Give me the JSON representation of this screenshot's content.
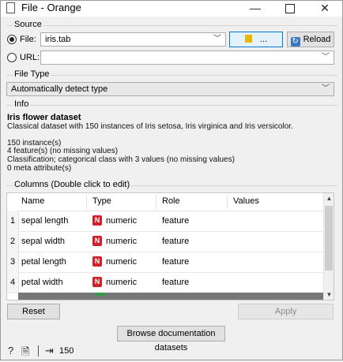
{
  "window": {
    "title": "File - Orange",
    "minimize": "—",
    "close": "✕"
  },
  "source": {
    "group_label": "Source",
    "file_label": "File:",
    "file_value": "iris.tab",
    "browse_label": "...",
    "reload_label": "Reload",
    "url_label": "URL:",
    "url_value": ""
  },
  "file_type": {
    "group_label": "File Type",
    "value": "Automatically detect type"
  },
  "info": {
    "group_label": "Info",
    "title": "Iris flower dataset",
    "description": "Classical dataset with 150 instances of Iris setosa, Iris virginica and Iris versicolor.",
    "lines": [
      "150 instance(s)",
      "4 feature(s) (no missing values)",
      "Classification; categorical class with 3 values (no missing values)",
      "0 meta attribute(s)"
    ]
  },
  "columns": {
    "group_label": "Columns (Double click to edit)",
    "headers": [
      "Name",
      "Type",
      "Role",
      "Values"
    ],
    "rows": [
      {
        "num": "1",
        "name": "sepal length",
        "type_badge": "N",
        "type": "numeric",
        "role": "feature",
        "values": ""
      },
      {
        "num": "2",
        "name": "sepal width",
        "type_badge": "N",
        "type": "numeric",
        "role": "feature",
        "values": ""
      },
      {
        "num": "3",
        "name": "petal length",
        "type_badge": "N",
        "type": "numeric",
        "role": "feature",
        "values": ""
      },
      {
        "num": "4",
        "name": "petal width",
        "type_badge": "N",
        "type": "numeric",
        "role": "feature",
        "values": ""
      }
    ]
  },
  "buttons": {
    "reset": "Reset",
    "apply": "Apply",
    "browse_docs": "Browse documentation datasets"
  },
  "status": {
    "output_count": "150",
    "help_icon": "?",
    "report_icon": "🗎",
    "output_icon": "⇥"
  },
  "colors": {
    "numeric_badge": "#d1202a",
    "accent": "#0078d7"
  }
}
